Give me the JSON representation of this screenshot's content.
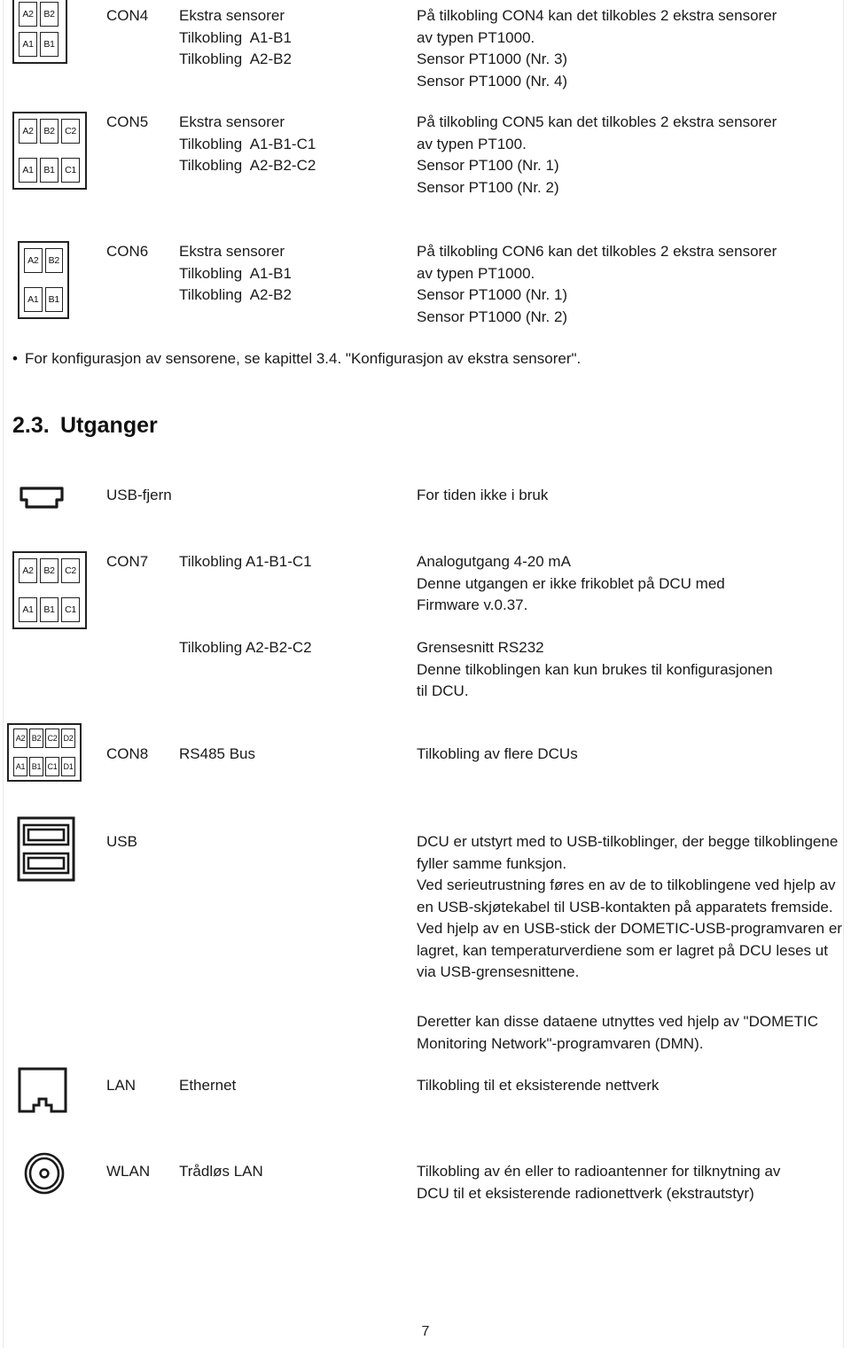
{
  "page": {
    "number": "7",
    "heading": {
      "number": "2.3.",
      "title": "Utganger"
    }
  },
  "connector_rows": [
    {
      "id": "con4",
      "con": "CON4",
      "mid_lines": [
        "Ekstra sensorer",
        "",
        "Tilkobling  A1-B1",
        "Tilkobling  A2-B2"
      ],
      "desc_lines": [
        "På tilkobling CON4 kan det tilkobles 2 ekstra sensorer",
        "av typen PT1000.",
        "Sensor PT1000  (Nr. 3)",
        "Sensor PT1000  (Nr. 4)"
      ],
      "icon": {
        "type": "terminal-block",
        "top_pins": [
          "A2",
          "B2"
        ],
        "bottom_pins": [
          "A1",
          "B1"
        ]
      }
    },
    {
      "id": "con5",
      "con": "CON5",
      "mid_lines": [
        "Ekstra sensorer",
        "",
        "Tilkobling  A1-B1-C1",
        "Tilkobling  A2-B2-C2"
      ],
      "desc_lines": [
        "På tilkobling CON5 kan det tilkobles 2 ekstra sensorer",
        "av typen PT100.",
        "Sensor PT100  (Nr. 1)",
        "Sensor PT100  (Nr. 2)"
      ],
      "icon": {
        "type": "terminal-block",
        "top_pins": [
          "A2",
          "B2",
          "C2"
        ],
        "bottom_pins": [
          "A1",
          "B1",
          "C1"
        ]
      }
    },
    {
      "id": "con6",
      "con": "CON6",
      "mid_lines": [
        "Ekstra sensorer",
        "Tilkobling  A1-B1",
        "Tilkobling  A2-B2"
      ],
      "desc_lines": [
        "På tilkobling CON6 kan det tilkobles 2 ekstra sensorer",
        "av typen PT1000.",
        "Sensor PT1000  (Nr. 1)",
        "Sensor PT1000  (Nr. 2)"
      ],
      "icon": {
        "type": "terminal-block",
        "top_pins": [
          "A2",
          "B2"
        ],
        "bottom_pins": [
          "A1",
          "B1"
        ]
      }
    }
  ],
  "bullet": "For konfigurasjon av sensorene, se kapittel 3.4. \"Konfigurasjon av ekstra sensorer\".",
  "output_rows": {
    "usb_fjern": {
      "label": "USB-fjern",
      "desc": "For tiden ikke i bruk",
      "icon_name": "usb-mini-connector-icon"
    },
    "con7": {
      "con": "CON7",
      "mid_line_1": "Tilkobling  A1-B1-C1",
      "mid_line_2": "Tilkobling  A2-B2-C2",
      "desc_block_1": [
        "Analogutgang   4-20 mA",
        "Denne utgangen er ikke frikoblet på DCU med",
        "Firmware v.0.37."
      ],
      "desc_block_2": [
        "Grensesnitt  RS232",
        "Denne tilkoblingen kan kun brukes til konfigurasjonen",
        "til DCU."
      ],
      "icon": {
        "type": "terminal-block",
        "top_pins": [
          "A2",
          "B2",
          "C2"
        ],
        "bottom_pins": [
          "A1",
          "B1",
          "C1"
        ]
      }
    },
    "con8": {
      "con": "CON8",
      "mid": "RS485 Bus",
      "desc": "Tilkobling av flere DCUs",
      "icon": {
        "type": "terminal-block",
        "top_pins": [
          "A2",
          "B2",
          "C2",
          "D2"
        ],
        "bottom_pins": [
          "A1",
          "B1",
          "C1",
          "D1"
        ]
      }
    },
    "usb": {
      "label": "USB",
      "icon_name": "usb-dual-port-icon",
      "desc_paragraph_1": "DCU er utstyrt med to USB-tilkoblinger, der begge tilkoblingene fyller samme funksjon.",
      "desc_paragraph_2": "Ved serieutrustning føres en av de to tilkoblingene ved hjelp av en USB-skjøtekabel til USB-kontakten på apparatets fremside. Ved hjelp av en USB-stick der DOMETIC-USB-programvaren er lagret, kan temperaturverdiene som er lagret på DCU leses ut via USB-grensesnittene.",
      "desc_paragraph_3": "Deretter kan disse dataene utnyttes ved hjelp av \"DOMETIC Monitoring Network\"-programvaren (DMN)."
    },
    "lan": {
      "label": "LAN",
      "mid": "Ethernet",
      "desc": "Tilkobling til et eksisterende nettverk",
      "icon_name": "rj45-ethernet-jack-icon"
    },
    "wlan": {
      "label": "WLAN",
      "mid": "Trådløs LAN",
      "desc_lines": [
        "Tilkobling av én eller to radioantenner for tilknytning av",
        "DCU til et eksisterende radionettverk (ekstrautstyr)"
      ],
      "icon_name": "antenna-coax-connector-icon"
    }
  }
}
